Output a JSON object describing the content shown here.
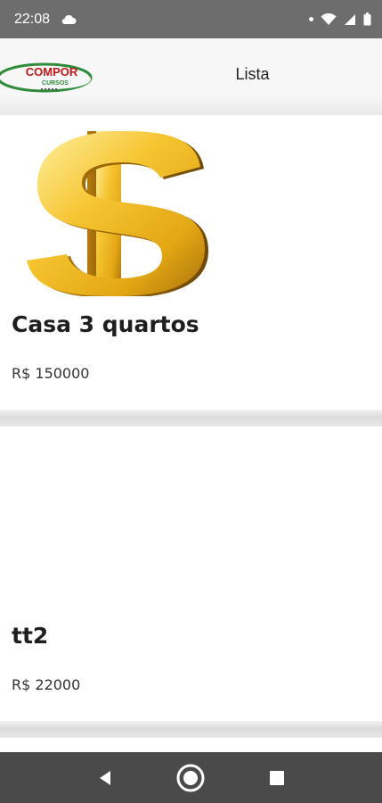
{
  "status_bar": {
    "time": "22:08",
    "icons": [
      "cloud-icon",
      "notification-dot-icon",
      "wifi-icon",
      "signal-icon",
      "battery-icon"
    ]
  },
  "app_bar": {
    "logo_text_main": "COMPOR",
    "logo_text_sub": "CURSOS",
    "title": "Lista"
  },
  "items": [
    {
      "title": "Casa 3 quartos",
      "price": "R$ 150000",
      "image": "gold-dollar-sign"
    },
    {
      "title": "tt2",
      "price": "R$ 22000",
      "image": ""
    }
  ],
  "nav_bar": {
    "icons": [
      "back-icon",
      "home-icon",
      "recents-icon"
    ]
  }
}
